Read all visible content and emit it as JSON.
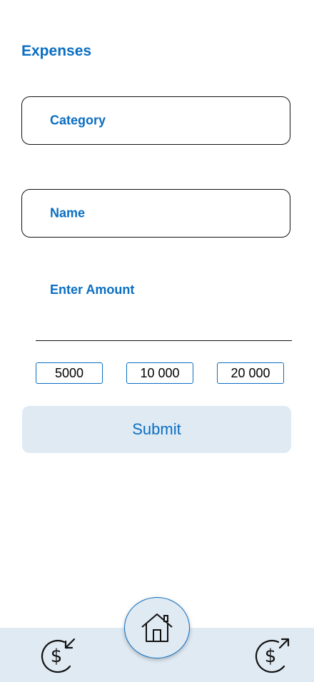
{
  "header": {
    "title": "Expenses"
  },
  "form": {
    "category_placeholder": "Category",
    "name_placeholder": "Name",
    "amount_placeholder": "Enter Amount",
    "quick_amounts": [
      "5000",
      "10 000",
      "20 000"
    ],
    "submit_label": "Submit"
  },
  "nav": {
    "left_icon": "income-money-icon",
    "center_icon": "home-icon",
    "right_icon": "expense-money-icon"
  },
  "colors": {
    "accent": "#0a6ec2",
    "button_bg": "#e0eaf3",
    "border": "#111111",
    "background": "#ffffff"
  }
}
